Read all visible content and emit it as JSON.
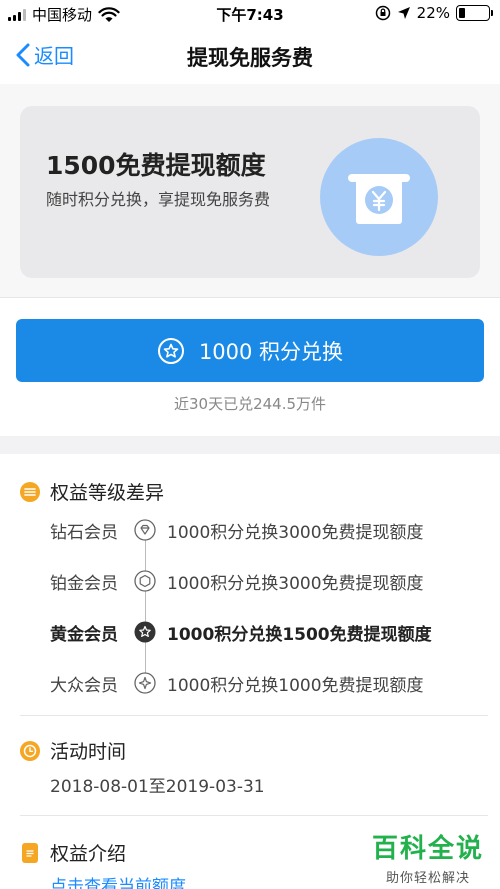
{
  "status_bar": {
    "carrier": "中国移动",
    "time": "下午7:43",
    "battery": "22%",
    "battery_level": 0.22
  },
  "nav": {
    "back_label": "返回",
    "title": "提现免服务费"
  },
  "hero": {
    "title": "1500免费提现额度",
    "description": "随时积分兑换，享提现免服务费",
    "icon": "yuan-withdraw-icon"
  },
  "redeem": {
    "button_label": "1000 积分兑换",
    "stat": "近30天已兑244.5万件"
  },
  "tiers": {
    "heading": "权益等级差异",
    "items": [
      {
        "name": "钻石会员",
        "detail": "1000积分兑换3000免费提现额度",
        "icon": "diamond-badge-icon"
      },
      {
        "name": "铂金会员",
        "detail": "1000积分兑换3000免费提现额度",
        "icon": "hexagon-badge-icon"
      },
      {
        "name": "黄金会员",
        "detail": "1000积分兑换1500免费提现额度",
        "icon": "star-badge-icon"
      },
      {
        "name": "大众会员",
        "detail": "1000积分兑换1000免费提现额度",
        "icon": "sparkle-badge-icon"
      }
    ]
  },
  "period": {
    "heading": "活动时间",
    "value": "2018-08-01至2019-03-31"
  },
  "intro": {
    "heading": "权益介绍",
    "link": "点击查看当前额度"
  },
  "watermark": {
    "title": "百科全说",
    "subtitle": "助你轻松解决"
  },
  "colors": {
    "accent": "#1a8ae6",
    "section_dot": "#f5a623",
    "hero_circle": "#a7cbf7"
  }
}
